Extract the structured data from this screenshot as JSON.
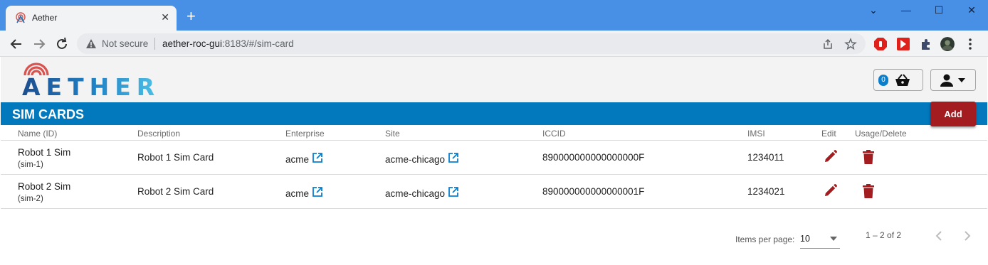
{
  "browser": {
    "tab_title": "Aether",
    "close_glyph": "✕",
    "new_tab_glyph": "+",
    "security_label": "Not secure",
    "url_host": "aether-roc-gui",
    "url_rest": ":8183/#/sim-card",
    "window_controls": [
      "⌄",
      "—",
      "☐",
      "✕"
    ]
  },
  "header": {
    "logo_text": "AETHER",
    "cart_count": "0"
  },
  "page": {
    "title": "SIM CARDS",
    "add_label": "Add"
  },
  "table": {
    "columns": [
      "Name (ID)",
      "Description",
      "Enterprise",
      "Site",
      "ICCID",
      "IMSI",
      "Edit",
      "Usage/Delete"
    ],
    "rows": [
      {
        "name": "Robot 1 Sim",
        "id": "(sim-1)",
        "description": "Robot 1 Sim Card",
        "enterprise": "acme",
        "site": "acme-chicago",
        "iccid": "890000000000000000F",
        "imsi": "1234011"
      },
      {
        "name": "Robot 2 Sim",
        "id": "(sim-2)",
        "description": "Robot 2 Sim Card",
        "enterprise": "acme",
        "site": "acme-chicago",
        "iccid": "890000000000000001F",
        "imsi": "1234021"
      }
    ]
  },
  "paginator": {
    "items_per_page_label": "Items per page:",
    "page_size": "10",
    "range_label": "1 – 2 of 2"
  },
  "colors": {
    "brand_blue": "#0278bd",
    "action_red": "#a31c1f",
    "link_blue": "#0a7ecb"
  }
}
